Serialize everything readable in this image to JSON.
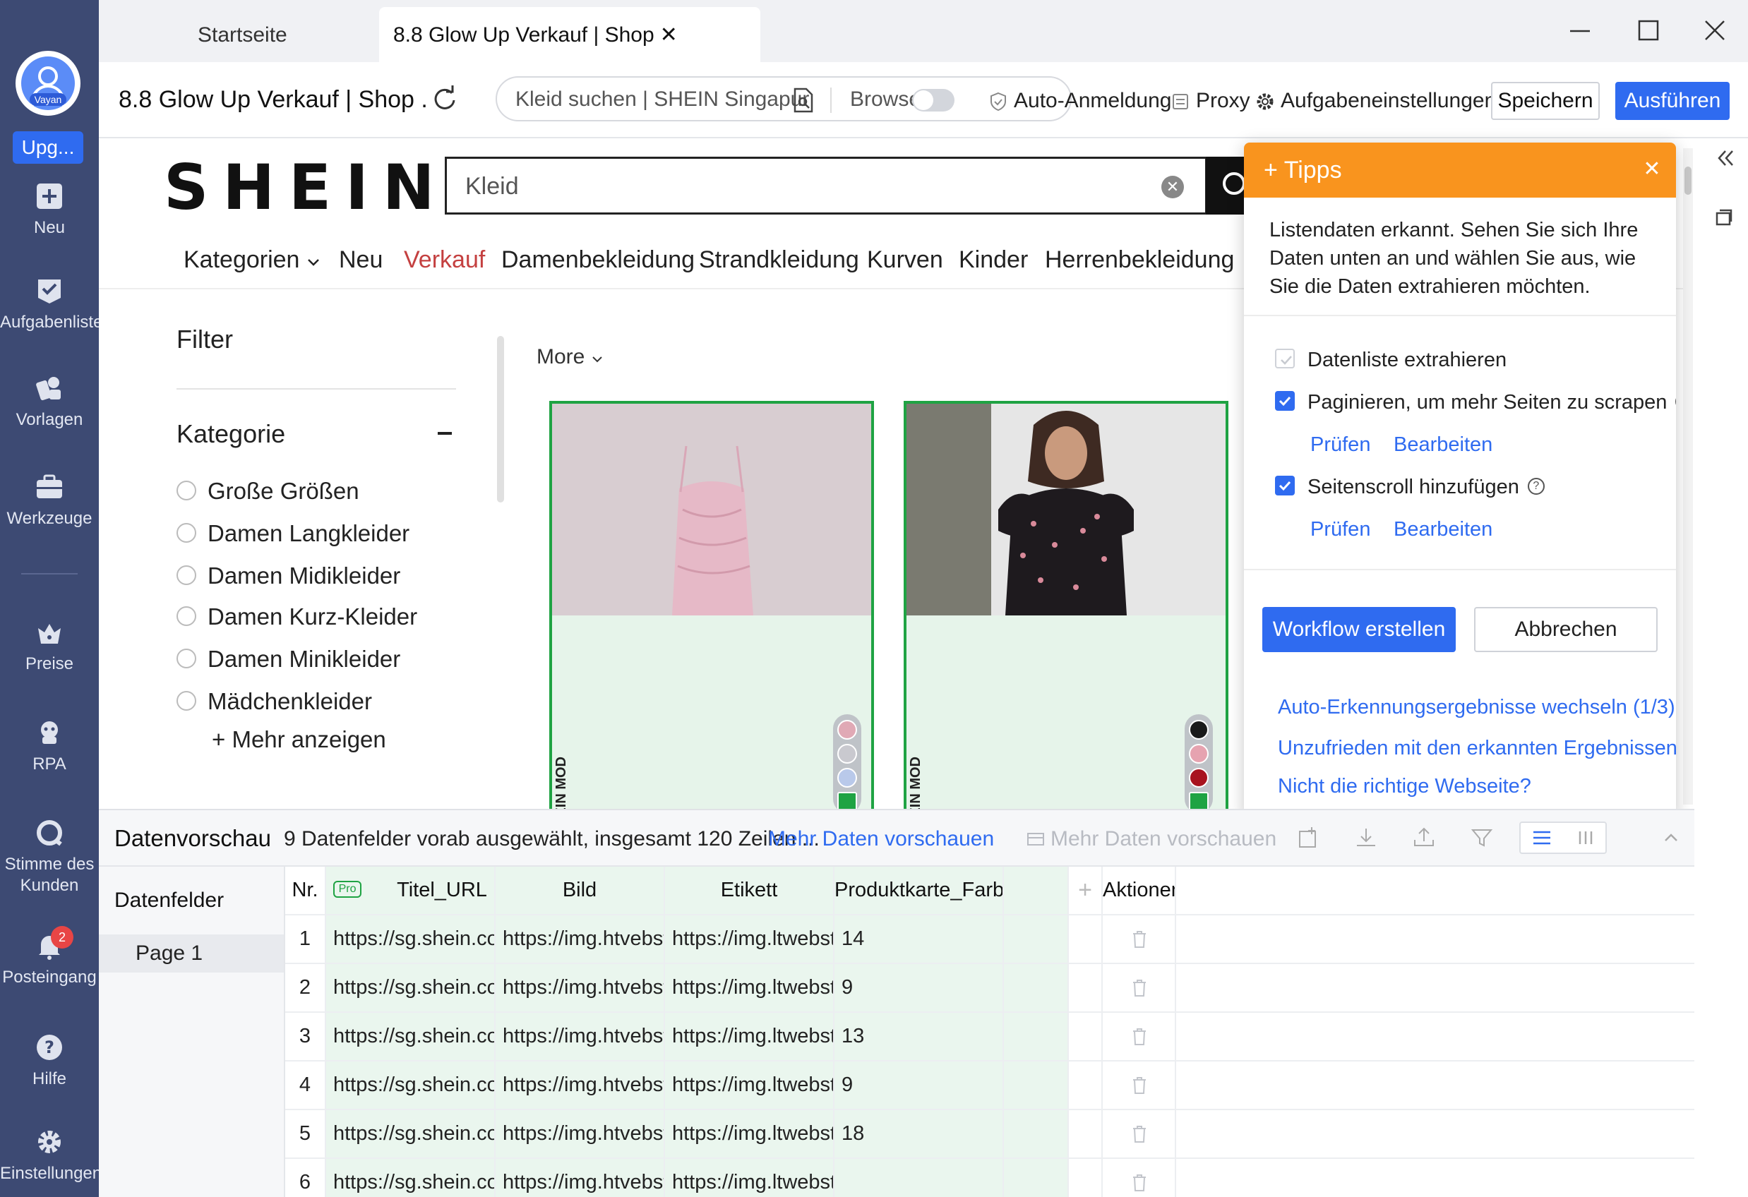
{
  "sidebar": {
    "avatar_tag": "Vayan",
    "upgrade_label": "Upg...",
    "items": [
      {
        "label": "Neu",
        "icon": "plus-square-icon"
      },
      {
        "label": "Aufgabenliste",
        "icon": "checklist-icon"
      },
      {
        "label": "Vorlagen",
        "icon": "templates-icon"
      },
      {
        "label": "Werkzeuge",
        "icon": "toolbox-icon"
      },
      {
        "label": "Preise",
        "icon": "crown-icon"
      },
      {
        "label": "RPA",
        "icon": "robot-icon"
      },
      {
        "label": "Stimme des Kunden",
        "icon": "feedback-icon"
      },
      {
        "label": "Posteingang",
        "icon": "bell-icon",
        "badge": "2"
      },
      {
        "label": "Hilfe",
        "icon": "help-icon"
      },
      {
        "label": "Einstellungen",
        "icon": "gear-icon"
      }
    ]
  },
  "tabs": [
    {
      "label": "Startseite",
      "active": false
    },
    {
      "label": "8.8 Glow Up Verkauf | Shop",
      "active": true
    }
  ],
  "toolbar": {
    "page_title": "8.8 Glow Up Verkauf | Shop ...",
    "url": "Kleid suchen | SHEIN Singapur",
    "browse_label": "Browse",
    "auto_login": "Auto-Anmeldung",
    "proxy": "Proxy",
    "task_settings": "Aufgabeneinstellungen",
    "save": "Speichern",
    "run": "Ausführen"
  },
  "web": {
    "logo": "SHEIN",
    "search_value": "Kleid",
    "menu": [
      {
        "label": "Kategorien",
        "hot": false
      },
      {
        "label": "Neu",
        "hot": false
      },
      {
        "label": "Verkauf",
        "hot": true
      },
      {
        "label": "Damenbekleidung",
        "hot": false
      },
      {
        "label": "Strandkleidung",
        "hot": false
      },
      {
        "label": "Kurven",
        "hot": false
      },
      {
        "label": "Kinder",
        "hot": false
      },
      {
        "label": "Herrenbekleidung",
        "hot": false
      }
    ],
    "filter_title": "Filter",
    "category_title": "Kategorie",
    "categories": [
      "Große Größen",
      "Damen Langkleider",
      "Damen Midikleider",
      "Damen Kurz-Kleider",
      "Damen Minikleider",
      "Mädchenkleider"
    ],
    "show_more": "Mehr anzeigen",
    "more": "More",
    "product_brand": "HEIN MOD"
  },
  "tips": {
    "title": "Tipps",
    "description": "Listendaten erkannt. Sehen Sie sich Ihre Daten unten an und wählen Sie aus, wie Sie die Daten extrahieren möchten.",
    "options": [
      {
        "label": "Datenliste extrahieren",
        "checked": false
      },
      {
        "label": "Paginieren, um mehr Seiten zu scrapen",
        "checked": true
      },
      {
        "label": "Seitenscroll hinzufügen",
        "checked": true
      }
    ],
    "check_link": "Prüfen",
    "edit_link": "Bearbeiten",
    "create_workflow": "Workflow erstellen",
    "cancel": "Abbrechen",
    "switch_results": "Auto-Erkennungsergebnisse wechseln (1/3)",
    "unsatisfied": "Unzufrieden mit den erkannten Ergebnissen?",
    "wrong_page": "Nicht die richtige Webseite?"
  },
  "preview": {
    "title": "Datenvorschau",
    "info": "9 Datenfelder vorab ausgewählt, insgesamt 120 Zeilen ...",
    "more_link": "Mehr Daten vorschauen",
    "more_disabled": "Mehr Daten vorschauen",
    "fields_title": "Datenfelder",
    "page_label": "Page 1",
    "pro_tag": "Pro",
    "columns": [
      "Nr.",
      "Titel_URL",
      "Bild",
      "Etikett",
      "Produktkarte_Farbe...",
      "",
      "+",
      "Aktionen"
    ],
    "rows": [
      [
        "1",
        "https://sg.shein.com/SHEIN-...",
        "https://img.htvebstatic.com/i...",
        "https://img.ltwebstatic.com/i...",
        "14"
      ],
      [
        "2",
        "https://sg.shein.com/SHEIN-...",
        "https://img.htvebstatic.com/i...",
        "https://img.ltwebstatic.com/i...",
        "9"
      ],
      [
        "3",
        "https://sg.shein.com/SHEIN-...",
        "https://img.htvebstatic.com/i...",
        "https://img.ltwebstatic.com/i...",
        "13"
      ],
      [
        "4",
        "https://sg.shein.com/SHEIN-...",
        "https://img.htvebstatic.com/i...",
        "https://img.ltwebstatic.com/i...",
        "9"
      ],
      [
        "5",
        "https://sg.shein.com/SHEIN-...",
        "https://img.htvebstatic.com/i...",
        "https://img.ltwebstatic.com/i...",
        "18"
      ],
      [
        "6",
        "https://sg.shein.com/SHEIN-...",
        "https://img.htvebstatic.com/i...",
        "https://img.ltwebstatic.com/i...",
        ""
      ]
    ]
  },
  "colors": {
    "sidebar": "#3d4a73",
    "accent": "#2f6bf0",
    "tips_header": "#f9941e",
    "selection_green": "#1fa343",
    "hot_menu": "#c44040"
  }
}
